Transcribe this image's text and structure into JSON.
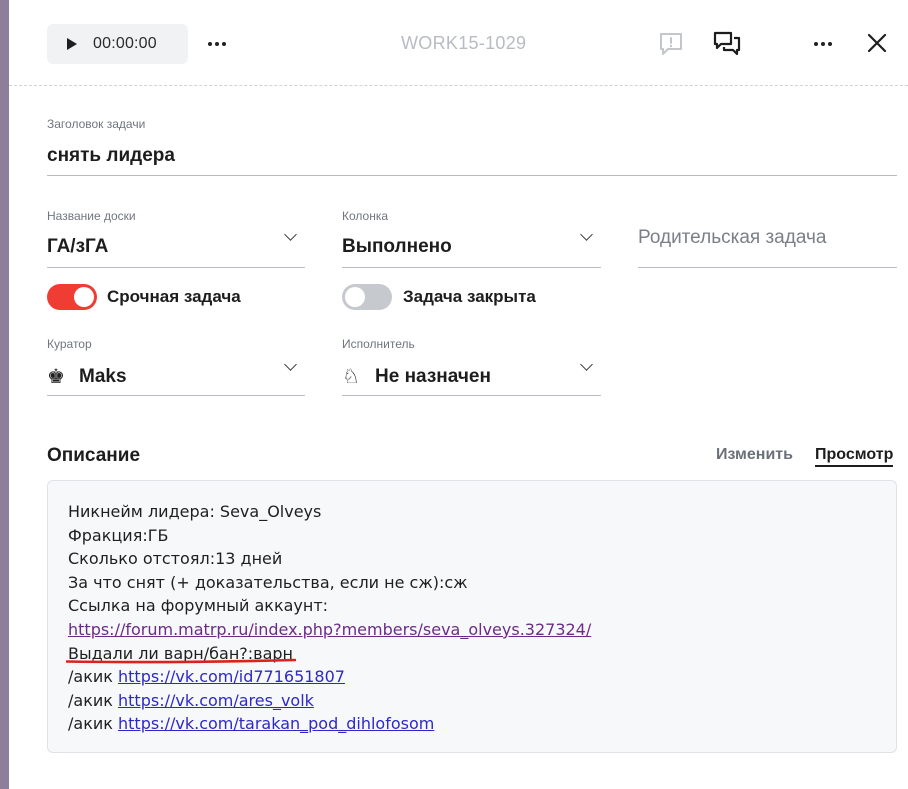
{
  "header": {
    "timer": "00:00:00",
    "task_id": "WORK15-1029"
  },
  "form": {
    "title_label": "Заголовок задачи",
    "title_value": "снять лидера",
    "board_label": "Название доски",
    "board_value": "ГА/зГА",
    "column_label": "Колонка",
    "column_value": "Выполнено",
    "parent_placeholder": "Родительская задача",
    "urgent_label": "Срочная задача",
    "urgent_on": true,
    "closed_label": "Задача закрыта",
    "closed_on": false,
    "curator_label": "Куратор",
    "curator_value": "Maks",
    "executor_label": "Исполнитель",
    "executor_value": "Не назначен"
  },
  "description": {
    "title": "Описание",
    "tab_edit": "Изменить",
    "tab_preview": "Просмотр",
    "line1": "Никнейм лидера: Seva_Olveys",
    "line2": "Фракция:ГБ",
    "line3": "Сколько отстоял:13 дней",
    "line4": "За что снят (+ доказательства, если не сж):сж",
    "line5": "Ссылка на форумный аккаунт:",
    "forum_link": "https://forum.matrp.ru/index.php?members/seva_olveys.327324/",
    "line7": "Выдали ли варн/бан?:варн",
    "akik_prefix": "/акик ",
    "akik_links": [
      "https://vk.com/id771651807",
      "https://vk.com/ares_volk",
      "https://vk.com/tarakan_pod_dihlofosom"
    ]
  },
  "colors": {
    "accent_toggle": "#ef3d33",
    "link": "#2d28c9",
    "link_visited": "#6c2b88"
  },
  "icons": {
    "play": "play-icon",
    "more": "more-dots-icon",
    "comment": "comment-alert-icon",
    "chat": "chat-icon",
    "close": "close-icon",
    "curator": "chess-king-icon",
    "executor": "chess-knight-icon"
  }
}
